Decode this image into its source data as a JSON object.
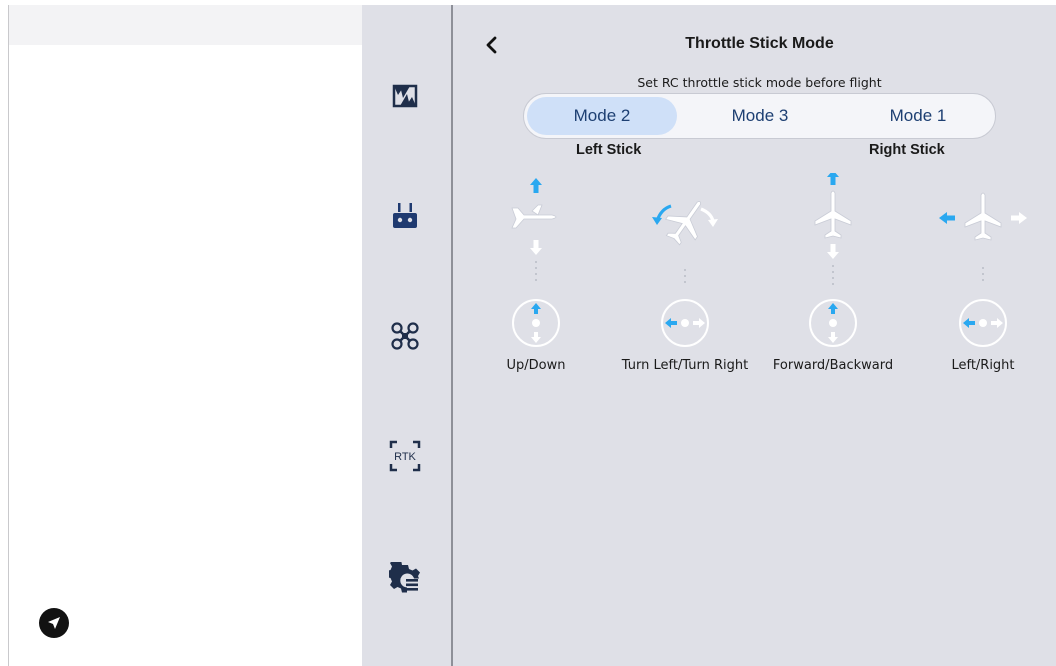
{
  "left_panel": {
    "send_icon": "send-arrow-icon"
  },
  "rail": {
    "items": [
      {
        "icon": "flight-route-icon"
      },
      {
        "icon": "remote-controller-icon"
      },
      {
        "icon": "drone-icon"
      },
      {
        "icon": "rtk-icon",
        "label": "RTK"
      },
      {
        "icon": "settings-icon"
      }
    ]
  },
  "header": {
    "back_icon": "chevron-left-icon",
    "title": "Throttle Stick Mode"
  },
  "subtitle": "Set RC throttle stick mode before flight",
  "modes": {
    "selected": "Mode 2",
    "options": [
      "Mode 2",
      "Mode 3",
      "Mode 1"
    ]
  },
  "sticks": {
    "left_label": "Left Stick",
    "right_label": "Right Stick"
  },
  "controls": [
    {
      "label": "Up/Down",
      "icon": "aircraft-up-down-icon"
    },
    {
      "label": "Turn Left/Turn Right",
      "icon": "aircraft-turn-icon"
    },
    {
      "label": "Forward/Backward",
      "icon": "aircraft-forward-backward-icon"
    },
    {
      "label": "Left/Right",
      "icon": "aircraft-left-right-icon"
    }
  ],
  "colors": {
    "accent": "#2aa8f0",
    "selected_mode_bg": "#cfe0f8",
    "mode_text": "#1d3f72",
    "panel_bg": "#dfe0e7"
  }
}
